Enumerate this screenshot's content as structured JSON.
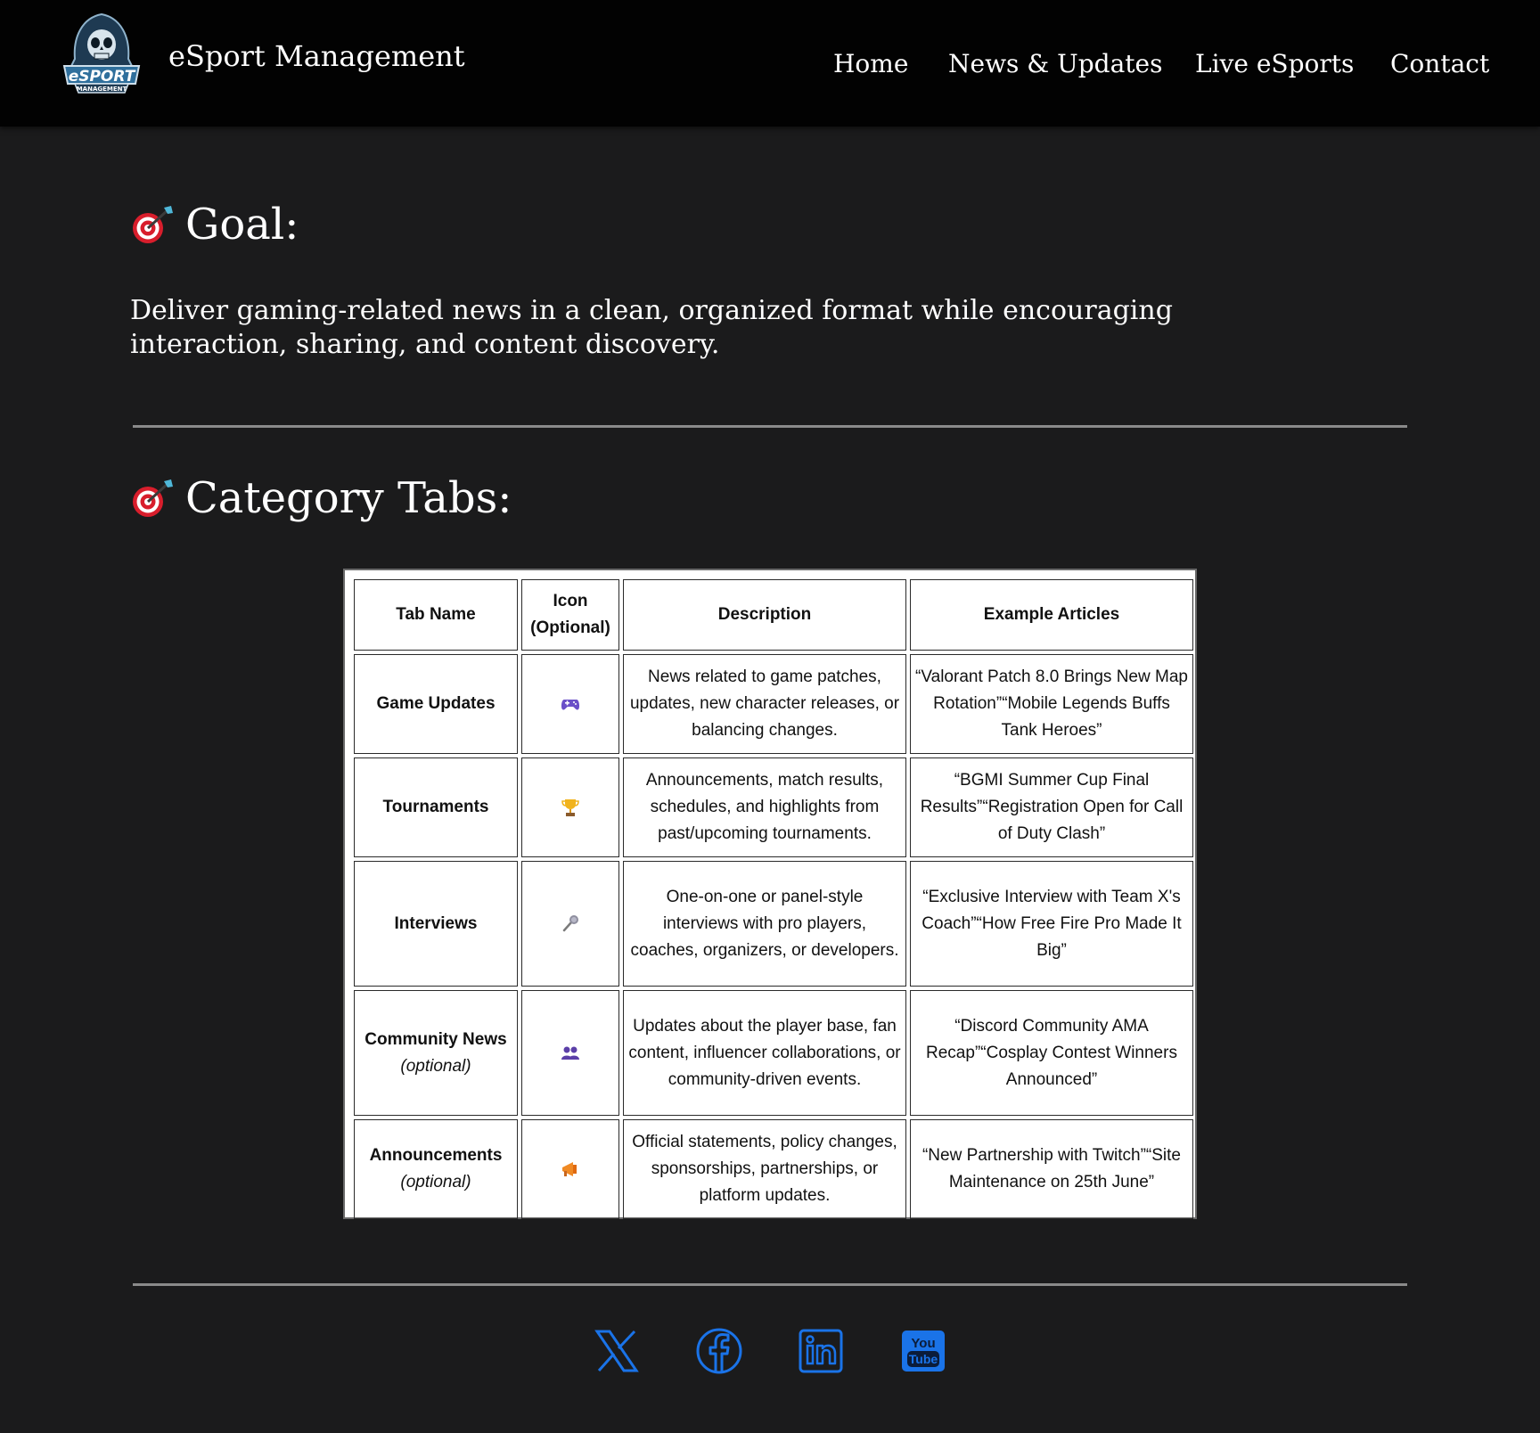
{
  "header": {
    "logo_text": "eSPORT",
    "logo_subtext": "MANAGEMENT",
    "brand": "eSport Management",
    "nav": [
      "Home",
      "News & Updates",
      "Live eSports",
      "Contact"
    ]
  },
  "goal": {
    "heading": "Goal:",
    "icon": "dart-target-icon",
    "text": "Deliver gaming-related news in a clean, organized format while encouraging interaction, sharing, and content discovery."
  },
  "categories": {
    "heading": "Category Tabs:",
    "icon": "dart-target-icon",
    "table": {
      "headers": [
        "Tab Name",
        "Icon (Optional)",
        "Description",
        "Example Articles"
      ],
      "rows": [
        {
          "name": "Game Updates",
          "optional": "",
          "icon": "gamepad-icon",
          "description": "News related to game patches, updates, new character releases, or balancing changes.",
          "examples": "“Valorant Patch 8.0 Brings New Map Rotation”“Mobile Legends Buffs Tank Heroes”"
        },
        {
          "name": "Tournaments",
          "optional": "",
          "icon": "trophy-icon",
          "description": "Announcements, match results, schedules, and highlights from past/upcoming tournaments.",
          "examples": "“BGMI Summer Cup Final Results”“Registration Open for Call of Duty Clash”"
        },
        {
          "name": "Interviews",
          "optional": "",
          "icon": "microphone-icon",
          "description": "One-on-one or panel-style interviews with pro players, coaches, organizers, or developers.",
          "examples": "“Exclusive Interview with Team X's Coach”“How Free Fire Pro Made It Big”"
        },
        {
          "name": "Community News",
          "optional": "(optional)",
          "icon": "people-icon",
          "description": "Updates about the player base, fan content, influencer collaborations, or community-driven events.",
          "examples": "“Discord Community AMA Recap”“Cosplay Contest Winners Announced”"
        },
        {
          "name": "Announcements",
          "optional": "(optional)",
          "icon": "megaphone-icon",
          "description": "Official statements, policy changes, sponsorships, partnerships, or platform updates.",
          "examples": "“New Partnership with Twitch”“Site Maintenance on 25th June”"
        }
      ]
    }
  },
  "social": {
    "icons": [
      "x-icon",
      "facebook-icon",
      "linkedin-icon",
      "youtube-icon"
    ],
    "youtube_text_top": "You",
    "youtube_text_bottom": "Tube",
    "color": "#1a73e8"
  },
  "colors": {
    "background": "#1b1b1c",
    "header": "#020202",
    "divider": "#8a8a8a",
    "social": "#1a73e8"
  }
}
